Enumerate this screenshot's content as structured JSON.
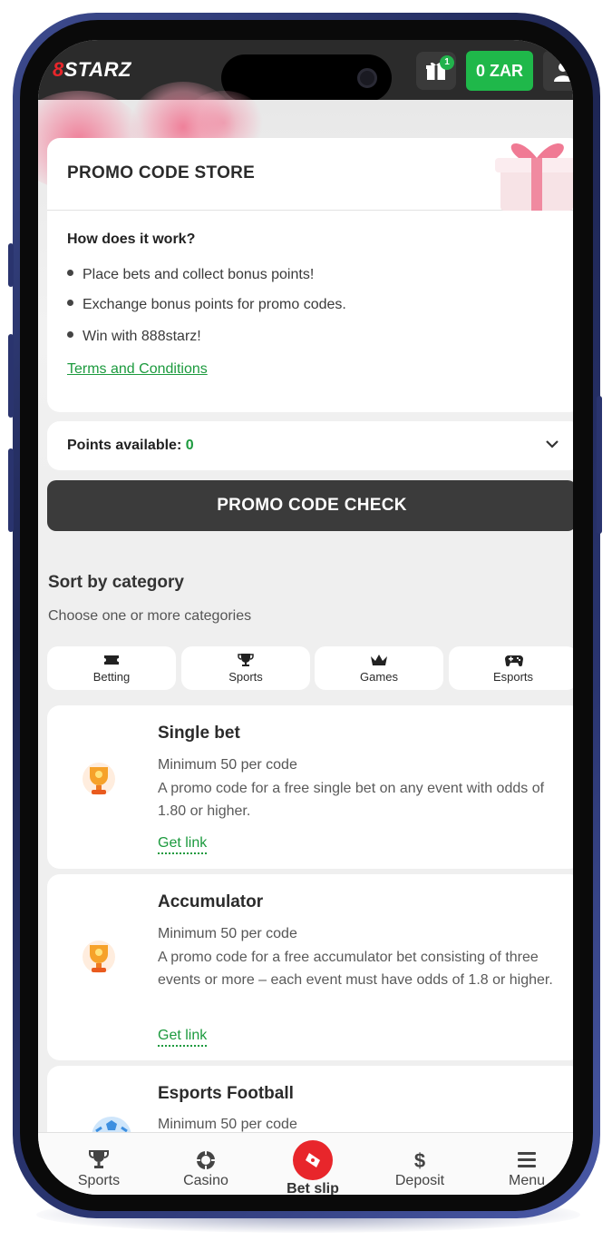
{
  "header": {
    "logo_prefix": "8",
    "logo_text": "STARZ",
    "gift_badge": "1",
    "balance": "0 ZAR"
  },
  "store": {
    "title": "PROMO CODE STORE",
    "how_title": "How does it work?",
    "steps": [
      "Place bets and collect bonus points!",
      "Exchange bonus points for promo codes.",
      "Win with 888starz!"
    ],
    "terms_link": "Terms and Conditions"
  },
  "points": {
    "label": "Points available: ",
    "value": "0"
  },
  "check_button": "PROMO CODE CHECK",
  "sort": {
    "title": "Sort by category",
    "subtitle": "Choose one or more categories",
    "categories": [
      {
        "label": "Betting",
        "icon": "ticket-icon"
      },
      {
        "label": "Sports",
        "icon": "trophy-icon"
      },
      {
        "label": "Games",
        "icon": "crown-icon"
      },
      {
        "label": "Esports",
        "icon": "gamepad-icon"
      }
    ]
  },
  "promos": [
    {
      "name": "Single bet",
      "minimum": "Minimum 50 per code",
      "description": "A promo code for a free single bet on any event with odds of 1.80 or higher.",
      "link": "Get link",
      "icon": "trophy-icon"
    },
    {
      "name": "Accumulator",
      "minimum": "Minimum 50 per code",
      "description": "A promo code for a free accumulator bet consisting of three events or more – each event must have odds of 1.8 or higher.",
      "link": "Get link",
      "icon": "trophy-icon"
    },
    {
      "name": "Esports Football",
      "minimum": "Minimum 50 per code",
      "icon": "football-icon"
    }
  ],
  "bottom_nav": [
    {
      "label": "Sports",
      "icon": "trophy-icon"
    },
    {
      "label": "Casino",
      "icon": "casino-chip-icon"
    },
    {
      "label": "Bet slip",
      "icon": "ticket-icon"
    },
    {
      "label": "Deposit",
      "icon": "dollar-icon"
    },
    {
      "label": "Menu",
      "icon": "hamburger-icon"
    }
  ],
  "colors": {
    "brand_red": "#e8262b",
    "accent_green": "#1fb84a",
    "dark_bar": "#2b2b2b"
  }
}
